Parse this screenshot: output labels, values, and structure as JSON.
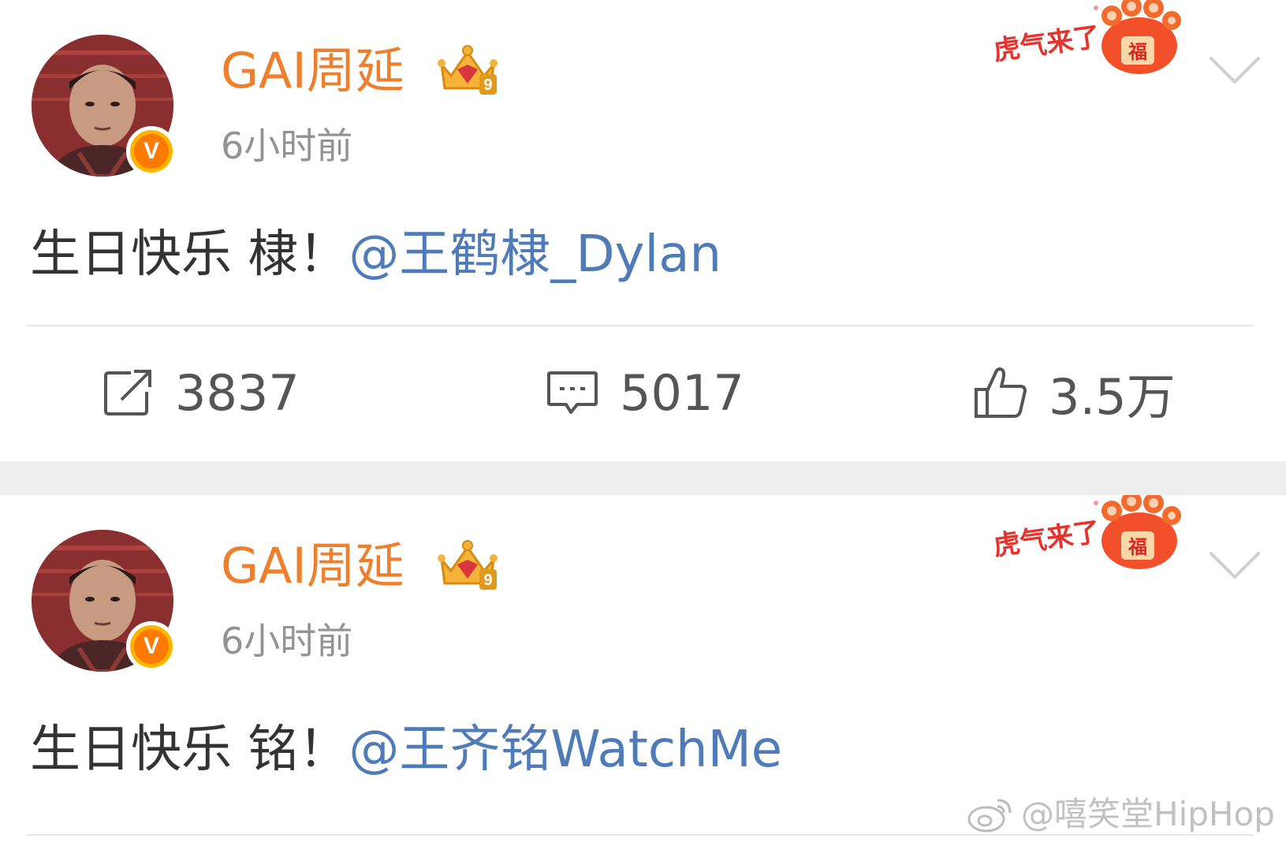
{
  "posts": [
    {
      "username": "GAI周延",
      "time": "6小时前",
      "text": "生日快乐 棣！",
      "mention": "@王鹤棣_Dylan",
      "repost_count": "3837",
      "comment_count": "5017",
      "like_count": "3.5万",
      "badge_text": "虎气来了",
      "verified_label": "V",
      "crown_level": "9"
    },
    {
      "username": "GAI周延",
      "time": "6小时前",
      "text": "生日快乐 铭！",
      "mention": "@王齐铭WatchMe",
      "badge_text": "虎气来了",
      "verified_label": "V",
      "crown_level": "9"
    }
  ],
  "watermark": "@嘻笑堂HipHop",
  "colors": {
    "username": "#ee7f2d",
    "mention": "#4f7cb8",
    "text": "#333333",
    "secondary": "#939393",
    "verified": "#ff7a00",
    "separator": "#eeeeee"
  },
  "icons": [
    "repost-icon",
    "comment-icon",
    "like-icon",
    "chevron-down-icon",
    "crown-icon",
    "verified-icon",
    "tiger-paw-icon",
    "weibo-logo-icon"
  ]
}
